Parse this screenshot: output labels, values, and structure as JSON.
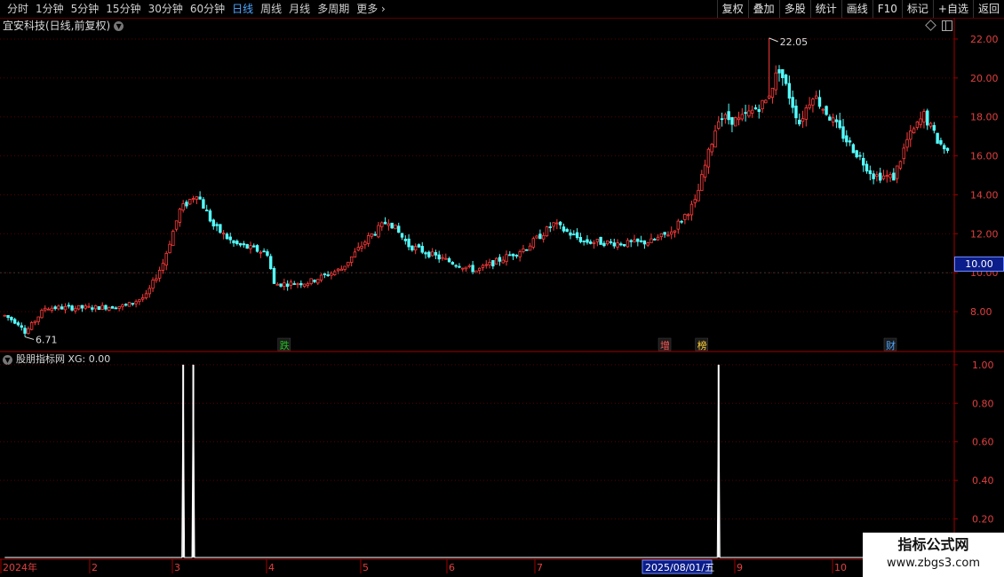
{
  "toolbar": {
    "periods": [
      "分时",
      "1分钟",
      "5分钟",
      "15分钟",
      "30分钟",
      "60分钟",
      "日线",
      "周线",
      "月线",
      "多周期",
      "更多"
    ],
    "active_period": "日线",
    "buttons": [
      "复权",
      "叠加",
      "多股",
      "统计",
      "画线",
      "F10",
      "标记",
      "+自选",
      "返回"
    ]
  },
  "chart": {
    "title": "宜安科技(日线,前复权)",
    "high_label": "22.05",
    "low_label": "6.71",
    "current_price": "10.00",
    "price_ticks": [
      "22.00",
      "20.00",
      "18.00",
      "16.00",
      "14.00",
      "12.00",
      "10.00",
      "8.00"
    ],
    "event_marks": [
      {
        "label": "跌",
        "color": "#22c022"
      },
      {
        "label": "增",
        "color": "#ff5555"
      },
      {
        "label": "榜",
        "color": "#ffd23a"
      },
      {
        "label": "财",
        "color": "#4ea6ff"
      }
    ]
  },
  "indicator": {
    "title": "股朋指标网 XG: 0.00",
    "ticks": [
      "1.00",
      "0.80",
      "0.60",
      "0.40",
      "0.20"
    ]
  },
  "x_axis": {
    "labels": [
      "2024年",
      "2",
      "3",
      "4",
      "5",
      "6",
      "7",
      "2025/08/01/五",
      "9",
      "10"
    ],
    "highlight": "2025/08/01/五"
  },
  "watermark": {
    "title": "指标公式网",
    "url": "www.zbgs3.com"
  },
  "colors": {
    "up": "#ff3b3b",
    "down": "#54ffff",
    "axis": "#a00000",
    "grid": "#5a0000",
    "highlight_box": "#0b1d8a"
  },
  "chart_data": [
    {
      "type": "candlestick",
      "title": "宜安科技(日线,前复权)",
      "ylim": [
        6.0,
        22.5
      ],
      "period_labels": [
        "2024年",
        "2",
        "3",
        "4",
        "5",
        "6",
        "7",
        "2025/08/01/五",
        "9",
        "10"
      ],
      "anchor_points": [
        [
          0,
          7.8
        ],
        [
          5,
          7.3
        ],
        [
          6,
          6.9
        ],
        [
          12,
          8.2
        ],
        [
          25,
          8.2
        ],
        [
          36,
          8.3
        ],
        [
          42,
          8.8
        ],
        [
          47,
          10.5
        ],
        [
          52,
          13.2
        ],
        [
          57,
          14.1
        ],
        [
          62,
          12.4
        ],
        [
          68,
          11.5
        ],
        [
          78,
          11.0
        ],
        [
          80,
          9.4
        ],
        [
          90,
          9.5
        ],
        [
          100,
          10.2
        ],
        [
          108,
          11.8
        ],
        [
          114,
          12.7
        ],
        [
          120,
          11.4
        ],
        [
          130,
          10.7
        ],
        [
          140,
          10.1
        ],
        [
          155,
          11.3
        ],
        [
          163,
          12.5
        ],
        [
          172,
          11.6
        ],
        [
          185,
          11.5
        ],
        [
          192,
          11.6
        ],
        [
          198,
          12.1
        ],
        [
          205,
          13.6
        ],
        [
          212,
          18.0
        ],
        [
          218,
          17.8
        ],
        [
          226,
          18.8
        ],
        [
          230,
          20.5
        ],
        [
          236,
          17.7
        ],
        [
          240,
          19.2
        ],
        [
          250,
          16.8
        ],
        [
          258,
          15.0
        ],
        [
          264,
          14.9
        ],
        [
          268,
          16.8
        ],
        [
          273,
          18.1
        ],
        [
          277,
          16.8
        ],
        [
          280,
          16.2
        ]
      ],
      "high": 22.05,
      "low": 6.71,
      "current": 10.0
    },
    {
      "type": "line",
      "title": "股朋指标网 XG: 0.00",
      "ylim": [
        0,
        1.05
      ],
      "yticks": [
        1.0,
        0.8,
        0.6,
        0.4,
        0.2
      ],
      "spikes": [
        53,
        56,
        212
      ]
    }
  ]
}
